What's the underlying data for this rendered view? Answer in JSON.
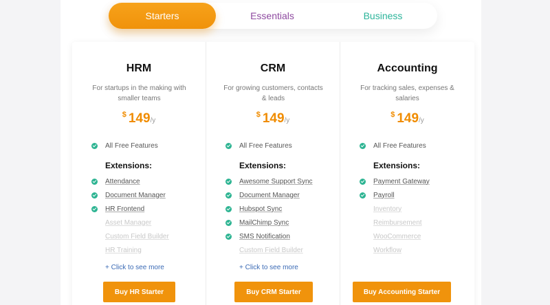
{
  "tabs": [
    {
      "label": "Starters",
      "active": true
    },
    {
      "label": "Essentials",
      "active": false
    },
    {
      "label": "Business",
      "active": false
    }
  ],
  "colors": {
    "accent": "#f0930c",
    "check": "#2db492",
    "essentials": "#8e4aa0",
    "business": "#2bb49a",
    "link": "#3a6ab5"
  },
  "extensions_heading": "Extensions:",
  "free_features": "All Free Features",
  "more_link": "+ Click to see more",
  "plans": [
    {
      "title": "HRM",
      "description": "For startups in the making with smaller teams",
      "currency": "$",
      "price": "149",
      "period": "/y",
      "extensions": [
        {
          "label": "Attendance",
          "included": true
        },
        {
          "label": "Document Manager",
          "included": true
        },
        {
          "label": "HR Frontend",
          "included": true
        },
        {
          "label": "Asset Manager",
          "included": false
        },
        {
          "label": "Custom Field Builder",
          "included": false
        },
        {
          "label": "HR Training",
          "included": false
        }
      ],
      "button": "Buy HR Starter"
    },
    {
      "title": "CRM",
      "description": "For growing customers, contacts & leads",
      "currency": "$",
      "price": "149",
      "period": "/y",
      "extensions": [
        {
          "label": "Awesome Support Sync",
          "included": true
        },
        {
          "label": "Document Manager",
          "included": true
        },
        {
          "label": "Hubspot Sync",
          "included": true
        },
        {
          "label": "MailChimp Sync",
          "included": true
        },
        {
          "label": "SMS Notification",
          "included": true
        },
        {
          "label": "Custom Field Builder",
          "included": false
        }
      ],
      "button": "Buy CRM Starter"
    },
    {
      "title": "Accounting",
      "description": "For tracking sales, expenses & salaries",
      "currency": "$",
      "price": "149",
      "period": "/y",
      "extensions": [
        {
          "label": "Payment Gateway",
          "included": true
        },
        {
          "label": "Payroll",
          "included": true
        },
        {
          "label": "Inventory",
          "included": false
        },
        {
          "label": "Reimbursement",
          "included": false
        },
        {
          "label": "WooCommerce",
          "included": false
        },
        {
          "label": "Workflow",
          "included": false
        }
      ],
      "button": "Buy Accounting Starter"
    }
  ]
}
